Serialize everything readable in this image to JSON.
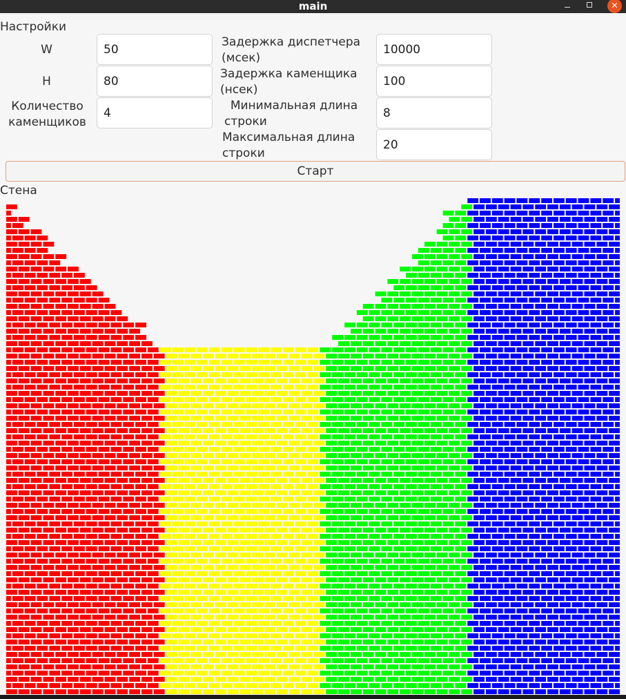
{
  "window": {
    "title": "main",
    "minimize_icon": "minimize-icon",
    "maximize_icon": "maximize-icon",
    "close_icon": "close-icon",
    "close_glyph": "✕",
    "close_color": "#e95420"
  },
  "settings": {
    "section_label": "Настройки",
    "w_label": "W",
    "w_value": "50",
    "h_label": "H",
    "h_value": "80",
    "masons_label_line1": "Количество",
    "masons_label_line2": "каменщиков",
    "masons_value": "4",
    "dispatcher_delay_line1": "Задержка диспетчера",
    "dispatcher_delay_line2": "(мсек)",
    "dispatcher_delay_value": "10000",
    "mason_delay_line1": "Задержка каменщика",
    "mason_delay_line2": "(нсек)",
    "mason_delay_value": "100",
    "min_len_line1": "Минимальная длина",
    "min_len_line2": "строки",
    "min_len_value": "8",
    "max_len_line1": "Максимальная длина",
    "max_len_line2": "строки",
    "max_len_value": "20",
    "start_button": "Старт"
  },
  "wall": {
    "label": "Стена",
    "width_bricks": 50,
    "height_rows": 80,
    "mortar_color": "#ffffff",
    "masons": [
      {
        "color": "#ff0000",
        "column_start": 0,
        "column_end": 13,
        "filled_rows": 79,
        "shape": "staircase-right"
      },
      {
        "color": "#ffff00",
        "column_start": 13,
        "column_end": 26,
        "filled_rows": 56,
        "shape": "flat"
      },
      {
        "color": "#00ff00",
        "column_start": 26,
        "column_end": 38,
        "filled_rows": 80,
        "shape": "staircase-left"
      },
      {
        "color": "#0000ff",
        "column_start": 38,
        "column_end": 50,
        "filled_rows": 80,
        "shape": "full"
      }
    ]
  }
}
